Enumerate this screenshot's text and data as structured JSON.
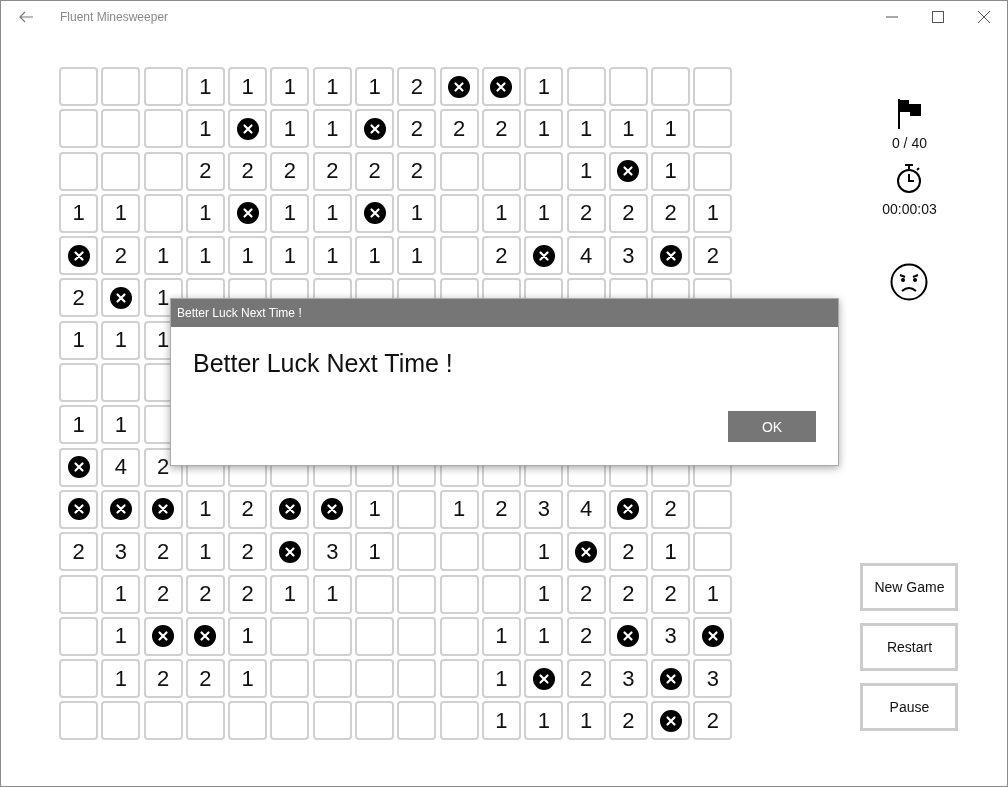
{
  "window": {
    "title": "Fluent Minesweeper"
  },
  "board": {
    "rows": [
      {
        "cells": [
          {
            "kind": "empty"
          },
          {
            "kind": "empty"
          },
          {
            "kind": "empty"
          },
          {
            "kind": "number",
            "text": "1"
          },
          {
            "kind": "number",
            "text": "1"
          },
          {
            "kind": "number",
            "text": "1"
          },
          {
            "kind": "number",
            "text": "1"
          },
          {
            "kind": "number",
            "text": "1"
          },
          {
            "kind": "number",
            "text": "2"
          },
          {
            "kind": "mine"
          },
          {
            "kind": "mine"
          },
          {
            "kind": "number",
            "text": "1"
          },
          {
            "kind": "empty"
          },
          {
            "kind": "empty"
          },
          {
            "kind": "empty"
          },
          {
            "kind": "empty"
          }
        ]
      },
      {
        "cells": [
          {
            "kind": "empty"
          },
          {
            "kind": "empty"
          },
          {
            "kind": "empty"
          },
          {
            "kind": "number",
            "text": "1"
          },
          {
            "kind": "mine"
          },
          {
            "kind": "number",
            "text": "1"
          },
          {
            "kind": "number",
            "text": "1"
          },
          {
            "kind": "mine"
          },
          {
            "kind": "number",
            "text": "2"
          },
          {
            "kind": "number",
            "text": "2"
          },
          {
            "kind": "number",
            "text": "2"
          },
          {
            "kind": "number",
            "text": "1"
          },
          {
            "kind": "number",
            "text": "1"
          },
          {
            "kind": "number",
            "text": "1"
          },
          {
            "kind": "number",
            "text": "1"
          },
          {
            "kind": "empty"
          }
        ]
      },
      {
        "cells": [
          {
            "kind": "empty"
          },
          {
            "kind": "empty"
          },
          {
            "kind": "empty"
          },
          {
            "kind": "number",
            "text": "2"
          },
          {
            "kind": "number",
            "text": "2"
          },
          {
            "kind": "number",
            "text": "2"
          },
          {
            "kind": "number",
            "text": "2"
          },
          {
            "kind": "number",
            "text": "2"
          },
          {
            "kind": "number",
            "text": "2"
          },
          {
            "kind": "empty"
          },
          {
            "kind": "empty"
          },
          {
            "kind": "empty"
          },
          {
            "kind": "number",
            "text": "1"
          },
          {
            "kind": "mine"
          },
          {
            "kind": "number",
            "text": "1"
          },
          {
            "kind": "empty"
          }
        ]
      },
      {
        "cells": [
          {
            "kind": "number",
            "text": "1"
          },
          {
            "kind": "number",
            "text": "1"
          },
          {
            "kind": "empty"
          },
          {
            "kind": "number",
            "text": "1"
          },
          {
            "kind": "mine"
          },
          {
            "kind": "number",
            "text": "1"
          },
          {
            "kind": "number",
            "text": "1"
          },
          {
            "kind": "mine"
          },
          {
            "kind": "number",
            "text": "1"
          },
          {
            "kind": "empty"
          },
          {
            "kind": "number",
            "text": "1"
          },
          {
            "kind": "number",
            "text": "1"
          },
          {
            "kind": "number",
            "text": "2"
          },
          {
            "kind": "number",
            "text": "2"
          },
          {
            "kind": "number",
            "text": "2"
          },
          {
            "kind": "number",
            "text": "1"
          }
        ]
      },
      {
        "cells": [
          {
            "kind": "mine"
          },
          {
            "kind": "number",
            "text": "2"
          },
          {
            "kind": "number",
            "text": "1"
          },
          {
            "kind": "number",
            "text": "1"
          },
          {
            "kind": "number",
            "text": "1"
          },
          {
            "kind": "number",
            "text": "1"
          },
          {
            "kind": "number",
            "text": "1"
          },
          {
            "kind": "number",
            "text": "1"
          },
          {
            "kind": "number",
            "text": "1"
          },
          {
            "kind": "empty"
          },
          {
            "kind": "number",
            "text": "2"
          },
          {
            "kind": "mine"
          },
          {
            "kind": "number",
            "text": "4"
          },
          {
            "kind": "number",
            "text": "3"
          },
          {
            "kind": "mine"
          },
          {
            "kind": "number",
            "text": "2"
          }
        ]
      },
      {
        "cells": [
          {
            "kind": "number",
            "text": "2"
          },
          {
            "kind": "mine"
          },
          {
            "kind": "number",
            "text": "1"
          },
          {
            "kind": "covered"
          },
          {
            "kind": "covered"
          },
          {
            "kind": "covered"
          },
          {
            "kind": "covered"
          },
          {
            "kind": "covered"
          },
          {
            "kind": "covered"
          },
          {
            "kind": "covered"
          },
          {
            "kind": "covered"
          },
          {
            "kind": "covered"
          },
          {
            "kind": "covered"
          },
          {
            "kind": "covered"
          },
          {
            "kind": "covered"
          },
          {
            "kind": "covered"
          }
        ]
      },
      {
        "cells": [
          {
            "kind": "number",
            "text": "1"
          },
          {
            "kind": "number",
            "text": "1"
          },
          {
            "kind": "number",
            "text": "1"
          }
        ]
      },
      {
        "cells": [
          {
            "kind": "empty"
          },
          {
            "kind": "empty"
          },
          {
            "kind": "empty"
          }
        ]
      },
      {
        "cells": [
          {
            "kind": "number",
            "text": "1"
          },
          {
            "kind": "number",
            "text": "1"
          },
          {
            "kind": "empty"
          }
        ]
      },
      {
        "cells": [
          {
            "kind": "mine"
          },
          {
            "kind": "number",
            "text": "4"
          },
          {
            "kind": "number",
            "text": "2"
          },
          {
            "kind": "covered"
          },
          {
            "kind": "covered"
          },
          {
            "kind": "covered"
          },
          {
            "kind": "covered"
          },
          {
            "kind": "covered"
          },
          {
            "kind": "covered"
          },
          {
            "kind": "covered"
          },
          {
            "kind": "covered"
          },
          {
            "kind": "covered"
          },
          {
            "kind": "covered"
          },
          {
            "kind": "covered"
          },
          {
            "kind": "covered"
          },
          {
            "kind": "covered"
          }
        ]
      },
      {
        "cells": [
          {
            "kind": "mine"
          },
          {
            "kind": "mine"
          },
          {
            "kind": "mine"
          },
          {
            "kind": "number",
            "text": "1"
          },
          {
            "kind": "number",
            "text": "2"
          },
          {
            "kind": "mine"
          },
          {
            "kind": "mine"
          },
          {
            "kind": "number",
            "text": "1"
          },
          {
            "kind": "empty"
          },
          {
            "kind": "number",
            "text": "1"
          },
          {
            "kind": "number",
            "text": "2"
          },
          {
            "kind": "number",
            "text": "3"
          },
          {
            "kind": "number",
            "text": "4"
          },
          {
            "kind": "mine"
          },
          {
            "kind": "number",
            "text": "2"
          },
          {
            "kind": "empty"
          }
        ]
      },
      {
        "cells": [
          {
            "kind": "number",
            "text": "2"
          },
          {
            "kind": "number",
            "text": "3"
          },
          {
            "kind": "number",
            "text": "2"
          },
          {
            "kind": "number",
            "text": "1"
          },
          {
            "kind": "number",
            "text": "2"
          },
          {
            "kind": "mine"
          },
          {
            "kind": "number",
            "text": "3"
          },
          {
            "kind": "number",
            "text": "1"
          },
          {
            "kind": "empty"
          },
          {
            "kind": "empty"
          },
          {
            "kind": "empty"
          },
          {
            "kind": "number",
            "text": "1"
          },
          {
            "kind": "mine"
          },
          {
            "kind": "number",
            "text": "2"
          },
          {
            "kind": "number",
            "text": "1"
          },
          {
            "kind": "empty"
          }
        ]
      },
      {
        "cells": [
          {
            "kind": "empty"
          },
          {
            "kind": "number",
            "text": "1"
          },
          {
            "kind": "number",
            "text": "2"
          },
          {
            "kind": "number",
            "text": "2"
          },
          {
            "kind": "number",
            "text": "2"
          },
          {
            "kind": "number",
            "text": "1"
          },
          {
            "kind": "number",
            "text": "1"
          },
          {
            "kind": "empty"
          },
          {
            "kind": "empty"
          },
          {
            "kind": "empty"
          },
          {
            "kind": "empty"
          },
          {
            "kind": "number",
            "text": "1"
          },
          {
            "kind": "number",
            "text": "2"
          },
          {
            "kind": "number",
            "text": "2"
          },
          {
            "kind": "number",
            "text": "2"
          },
          {
            "kind": "number",
            "text": "1"
          }
        ]
      },
      {
        "cells": [
          {
            "kind": "empty"
          },
          {
            "kind": "number",
            "text": "1"
          },
          {
            "kind": "mine"
          },
          {
            "kind": "mine"
          },
          {
            "kind": "number",
            "text": "1"
          },
          {
            "kind": "empty"
          },
          {
            "kind": "empty"
          },
          {
            "kind": "empty"
          },
          {
            "kind": "empty"
          },
          {
            "kind": "empty"
          },
          {
            "kind": "number",
            "text": "1"
          },
          {
            "kind": "number",
            "text": "1"
          },
          {
            "kind": "number",
            "text": "2"
          },
          {
            "kind": "mine"
          },
          {
            "kind": "number",
            "text": "3"
          },
          {
            "kind": "mine"
          }
        ]
      },
      {
        "cells": [
          {
            "kind": "empty"
          },
          {
            "kind": "number",
            "text": "1"
          },
          {
            "kind": "number",
            "text": "2"
          },
          {
            "kind": "number",
            "text": "2"
          },
          {
            "kind": "number",
            "text": "1"
          },
          {
            "kind": "empty"
          },
          {
            "kind": "empty"
          },
          {
            "kind": "empty"
          },
          {
            "kind": "empty"
          },
          {
            "kind": "empty"
          },
          {
            "kind": "number",
            "text": "1"
          },
          {
            "kind": "mine"
          },
          {
            "kind": "number",
            "text": "2"
          },
          {
            "kind": "number",
            "text": "3"
          },
          {
            "kind": "mine"
          },
          {
            "kind": "number",
            "text": "3"
          }
        ]
      },
      {
        "cells": [
          {
            "kind": "empty"
          },
          {
            "kind": "empty"
          },
          {
            "kind": "empty"
          },
          {
            "kind": "empty"
          },
          {
            "kind": "empty"
          },
          {
            "kind": "empty"
          },
          {
            "kind": "empty"
          },
          {
            "kind": "empty"
          },
          {
            "kind": "empty"
          },
          {
            "kind": "empty"
          },
          {
            "kind": "number",
            "text": "1"
          },
          {
            "kind": "number",
            "text": "1"
          },
          {
            "kind": "number",
            "text": "1"
          },
          {
            "kind": "number",
            "text": "2"
          },
          {
            "kind": "mine"
          },
          {
            "kind": "number",
            "text": "2"
          }
        ]
      }
    ]
  },
  "status": {
    "flags": "0 / 40",
    "time": "00:00:03"
  },
  "buttons": [
    "New Game",
    "Restart",
    "Pause"
  ],
  "dialog": {
    "title": "Better Luck Next Time !",
    "message": "Better Luck Next Time !",
    "button": "OK"
  }
}
